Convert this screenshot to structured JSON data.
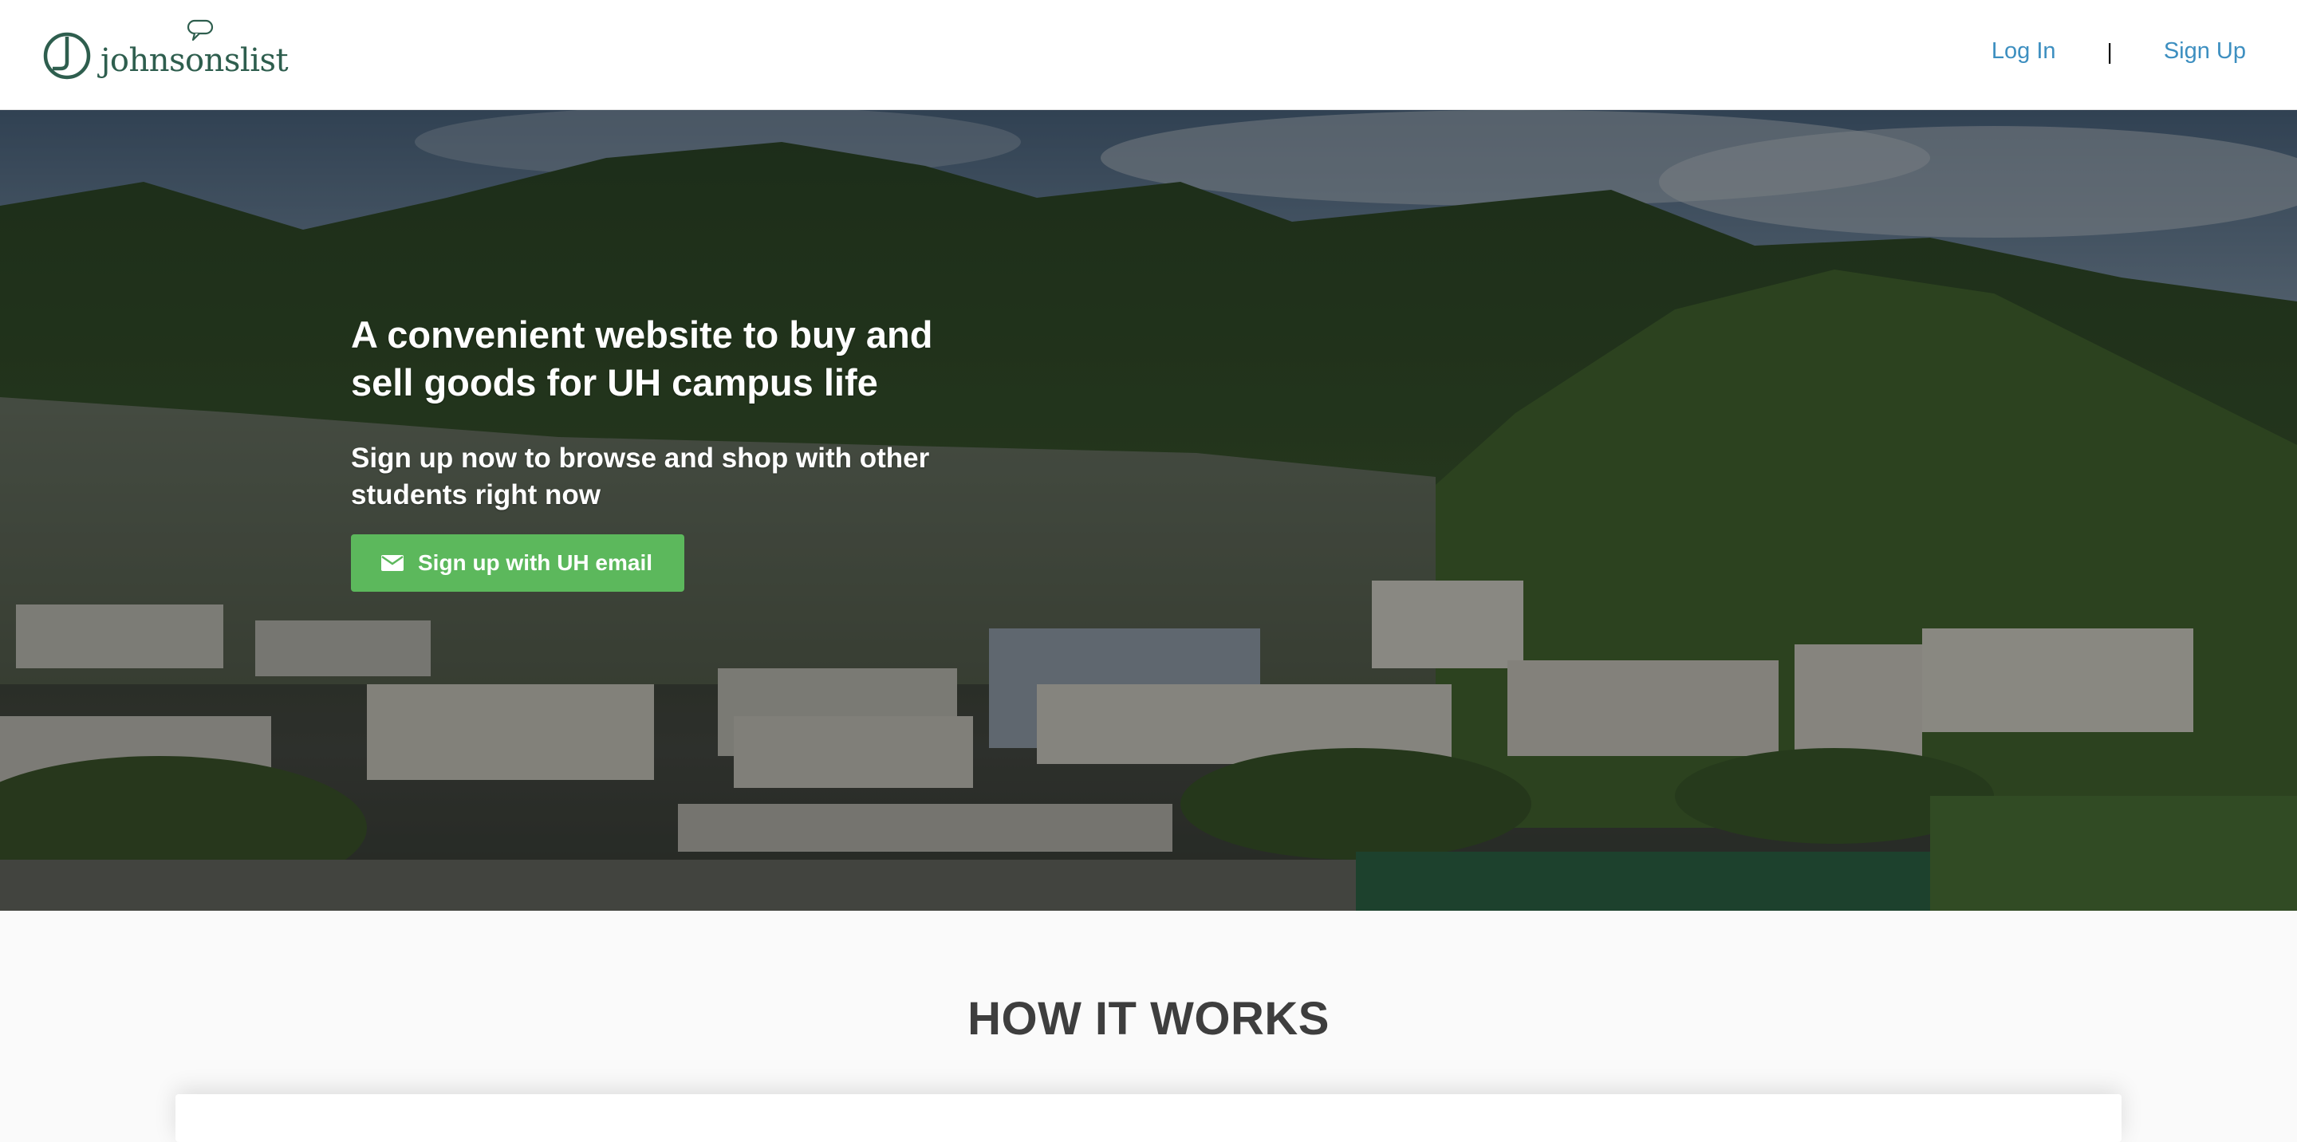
{
  "header": {
    "logo_text": "johnsonslist",
    "login_label": "Log In",
    "separator": "|",
    "signup_label": "Sign Up"
  },
  "hero": {
    "title": "A convenient website to buy and sell goods for UH campus life",
    "subtitle": "Sign up now to browse and shop with other students right now",
    "cta_label": "Sign up with UH email",
    "cta_icon": "envelope-icon",
    "cta_color": "#5cb85c"
  },
  "how_it_works": {
    "title": "HOW IT WORKS"
  },
  "colors": {
    "brand_green": "#2e5e4e",
    "link_blue": "#3d8fc0",
    "page_bg": "#fafafa"
  }
}
